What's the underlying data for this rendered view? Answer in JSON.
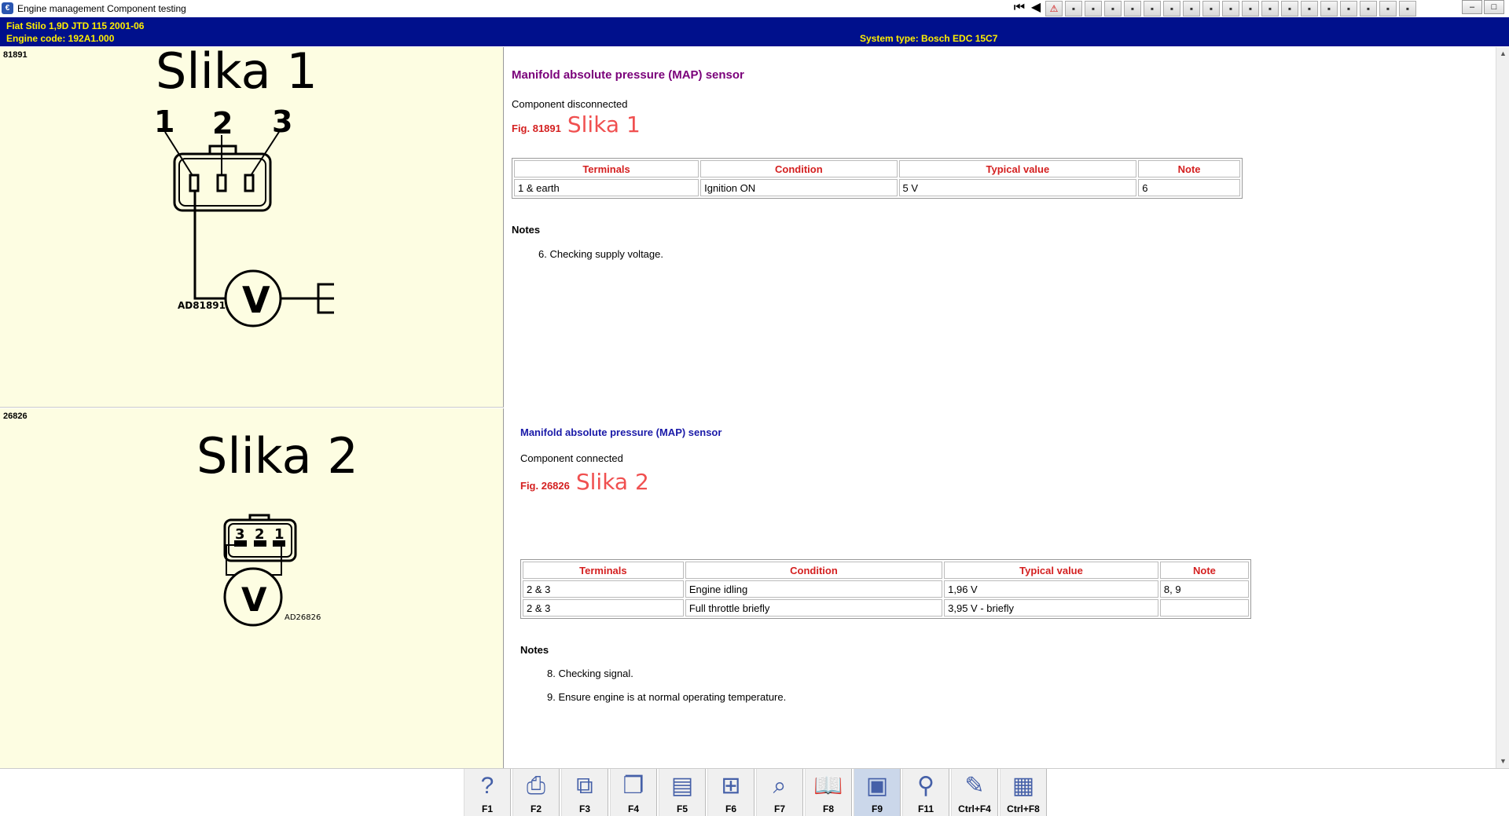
{
  "window": {
    "title": "Engine management Component testing",
    "app_icon": "€"
  },
  "toolbar": {
    "icons": [
      "first-page-icon",
      "previous-icon",
      "warning-icon",
      "document-icon",
      "image-icon",
      "gear-icon",
      "tools-icon",
      "settings-icon",
      "help-image-icon",
      "folder-icon",
      "car-icon",
      "diagram-icon",
      "wrench-icon",
      "battery-icon",
      "screen-icon",
      "calculator-icon",
      "lightbulb-icon",
      "printer-icon",
      "globe-icon",
      "network-icon",
      "note-icon"
    ]
  },
  "header": {
    "vehicle_line": "Fiat   Stilo  1,9D JTD 115 2001-06",
    "engine_line": "Engine code: 192A1.000",
    "system_line": "System type: Bosch EDC 15C7"
  },
  "figures": [
    {
      "id": "81891",
      "caption": "Slika 1",
      "pins": [
        "1",
        "2",
        "3"
      ],
      "meter": "V",
      "code": "AD81891"
    },
    {
      "id": "26826",
      "caption": "Slika 2",
      "pins": [
        "3",
        "2",
        "1"
      ],
      "meter": "V",
      "code": "AD26826"
    }
  ],
  "sections": [
    {
      "title": "Manifold absolute pressure (MAP) sensor",
      "status": "Component disconnected",
      "fig_label": "Fig. 81891",
      "fig_note": "Slika 1",
      "columns": [
        "Terminals",
        "Condition",
        "Typical value",
        "Note"
      ],
      "rows": [
        [
          "1 & earth",
          "Ignition ON",
          "5 V",
          "6"
        ]
      ],
      "notes_heading": "Notes",
      "notes": [
        "6.  Checking supply voltage."
      ]
    },
    {
      "title": "Manifold absolute pressure (MAP) sensor",
      "status": "Component connected",
      "fig_label": "Fig. 26826",
      "fig_note": "Slika 2",
      "columns": [
        "Terminals",
        "Condition",
        "Typical value",
        "Note"
      ],
      "rows": [
        [
          "2 & 3",
          "Engine idling",
          "1,96 V",
          "8, 9"
        ],
        [
          "2 & 3",
          "Full throttle briefly",
          "3,95 V - briefly",
          ""
        ]
      ],
      "notes_heading": "Notes",
      "notes": [
        "8.  Checking signal.",
        "9.  Ensure engine is at normal operating temperature."
      ]
    }
  ],
  "function_keys": [
    {
      "key": "F1",
      "icon": "help-icon",
      "glyph": "?"
    },
    {
      "key": "F2",
      "icon": "printer-icon",
      "glyph": "⎙"
    },
    {
      "key": "F3",
      "icon": "copy-icon",
      "glyph": "⧉"
    },
    {
      "key": "F4",
      "icon": "pages-icon",
      "glyph": "❐"
    },
    {
      "key": "F5",
      "icon": "document-icon",
      "glyph": "▤"
    },
    {
      "key": "F6",
      "icon": "component-icon",
      "glyph": "⊞"
    },
    {
      "key": "F7",
      "icon": "magnifier-icon",
      "glyph": "⌕"
    },
    {
      "key": "F8",
      "icon": "book-icon",
      "glyph": "📖"
    },
    {
      "key": "F9",
      "icon": "figure-icon",
      "glyph": "▣",
      "active": true
    },
    {
      "key": "F11",
      "icon": "search-vehicle-icon",
      "glyph": "⚲"
    },
    {
      "key": "Ctrl+F4",
      "icon": "notepad-icon",
      "glyph": "✎"
    },
    {
      "key": "Ctrl+F8",
      "icon": "table-icon",
      "glyph": "▦"
    }
  ],
  "colors": {
    "header_bg": "#00108c",
    "header_text": "#ffee00",
    "figure_bg": "#fdfde2",
    "section1_title": "#7a007a",
    "section2_title": "#1a1aa8",
    "table_header": "#d42020",
    "slika_note": "#f05050"
  }
}
